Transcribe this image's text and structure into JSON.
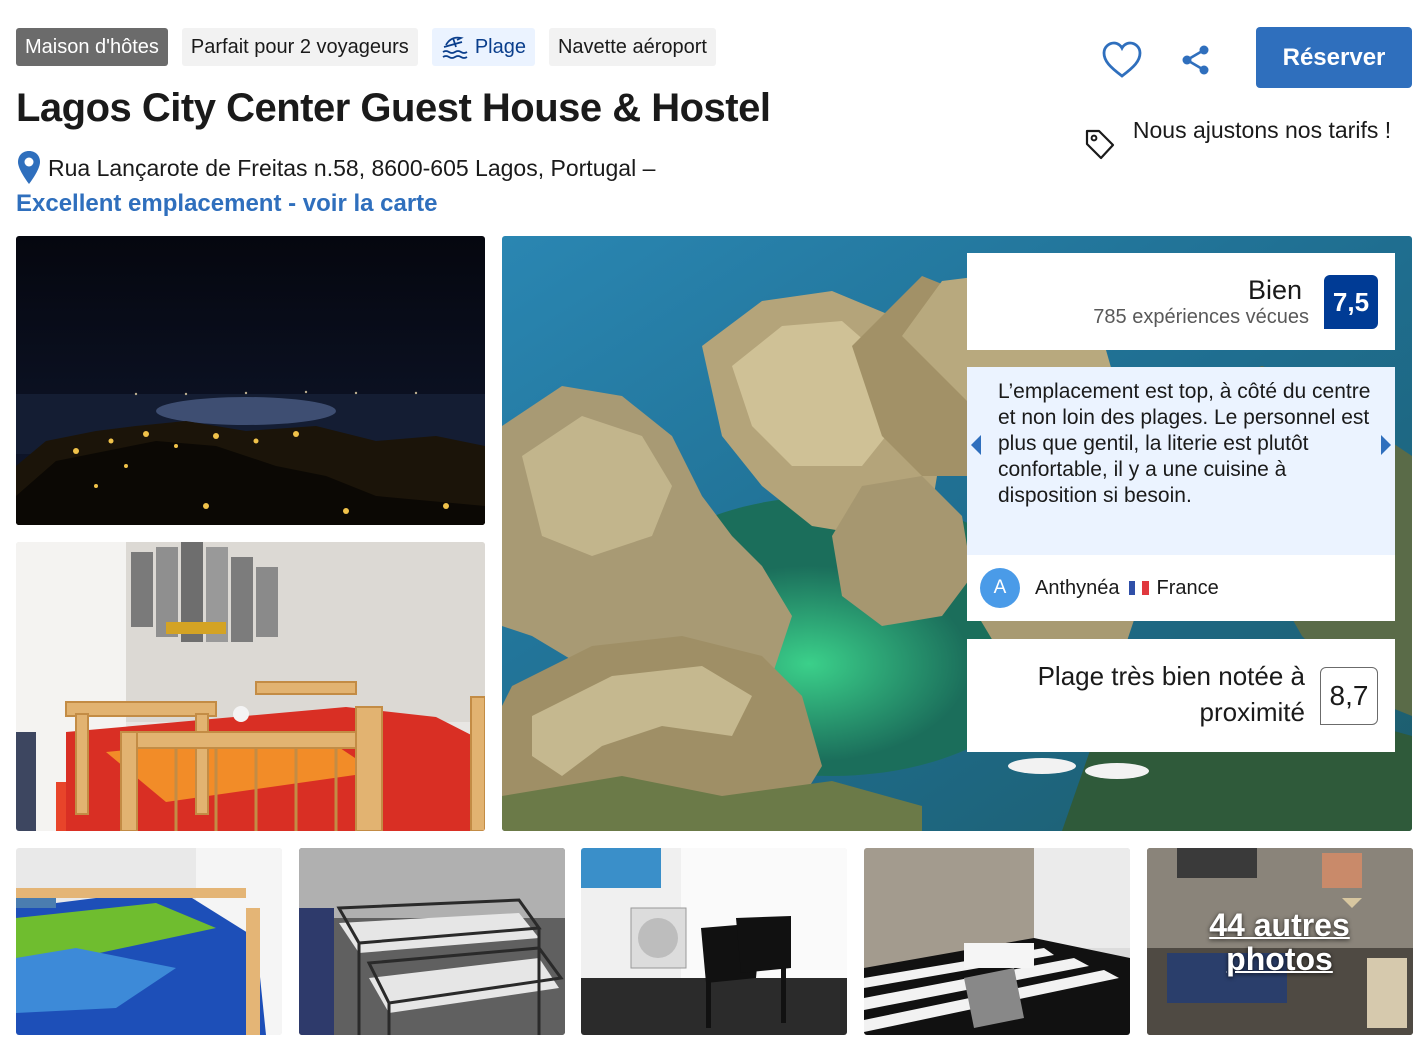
{
  "tags": [
    {
      "label": "Maison d'hôtes"
    },
    {
      "label": "Parfait pour 2 voyageurs"
    },
    {
      "label": "Plage",
      "icon": "beach-icon"
    },
    {
      "label": "Navette aéroport"
    }
  ],
  "property": {
    "name": "Lagos City Center Guest House & Hostel",
    "address": "Rua Lançarote de Freitas n.58, 8600-605 Lagos, Portugal –",
    "map_link": "Excellent emplacement - voir la carte"
  },
  "actions": {
    "save_icon": "heart-icon",
    "share_icon": "share-icon",
    "reserve_label": "Réserver"
  },
  "price_note": {
    "icon": "price-tag-icon",
    "text": "Nous ajustons nos tarifs !"
  },
  "review": {
    "score_word": "Bien",
    "count_text": "785 expériences vécues",
    "score": "7,5",
    "quote": "L’emplacement est top, à côté du centre et non loin des plages. Le personnel est plus que gentil, la literie est plutôt confortable, il y a une cuisine à disposition si besoin.",
    "author_initial": "A",
    "author_name": "Anthynéa",
    "author_country": "France"
  },
  "beach_rating": {
    "text": "Plage très bien notée à proximité",
    "score": "8,7"
  },
  "gallery": {
    "more_photos_line1": "44 autres",
    "more_photos_line2": "photos"
  },
  "colors": {
    "accent": "#2f6fbd",
    "score_badge": "#003b95",
    "quote_bg": "#ebf3ff",
    "tag_dark": "#6b6b6b"
  }
}
